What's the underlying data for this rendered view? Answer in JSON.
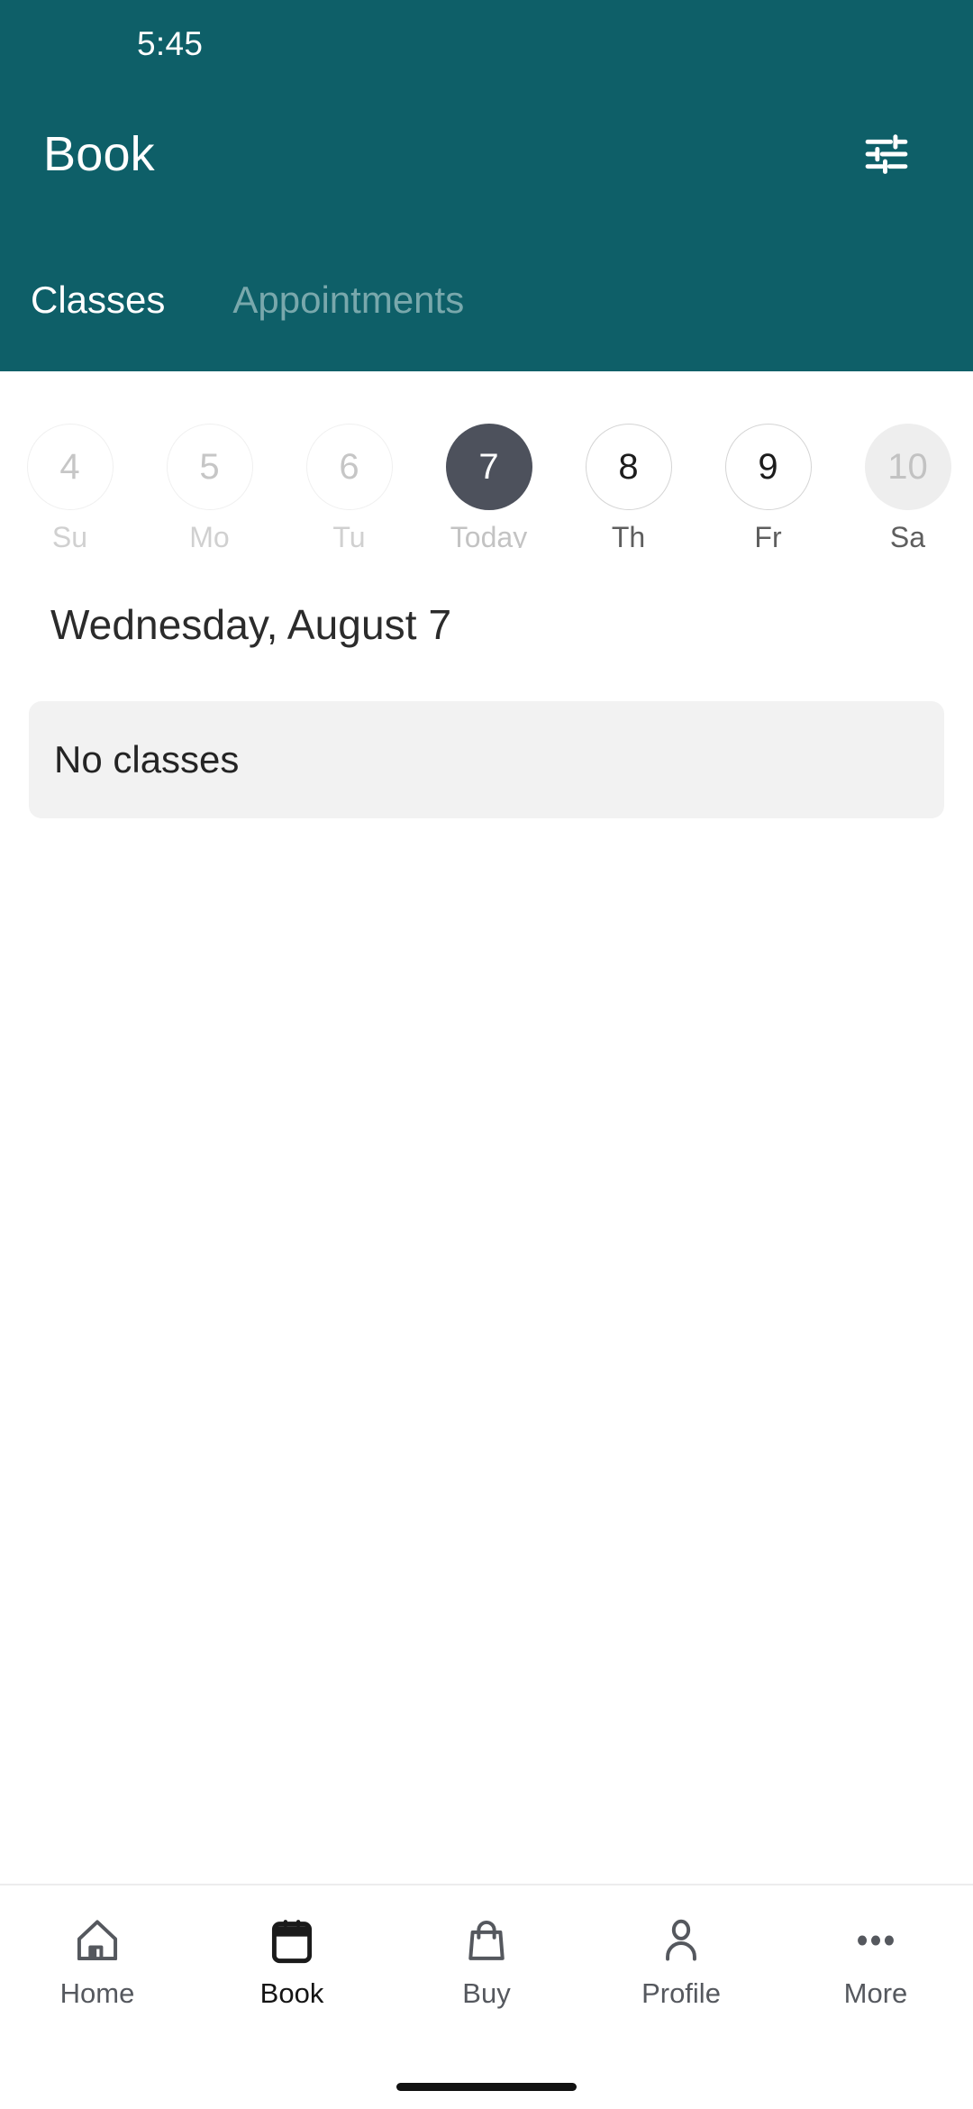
{
  "status_bar": {
    "time": "5:45"
  },
  "header": {
    "title": "Book",
    "filter_icon": "tune-icon",
    "background_color": "#0e5f68",
    "tabs": [
      {
        "label": "Classes",
        "active": true
      },
      {
        "label": "Appointments",
        "active": false
      }
    ]
  },
  "date_strip": {
    "days": [
      {
        "number": "4",
        "weekday": "Su",
        "state": "past"
      },
      {
        "number": "5",
        "weekday": "Mo",
        "state": "past"
      },
      {
        "number": "6",
        "weekday": "Tu",
        "state": "past"
      },
      {
        "number": "7",
        "weekday": "Today",
        "state": "selected"
      },
      {
        "number": "8",
        "weekday": "Th",
        "state": "future"
      },
      {
        "number": "9",
        "weekday": "Fr",
        "state": "future"
      },
      {
        "number": "10",
        "weekday": "Sa",
        "state": "highlight"
      }
    ],
    "selected_color": "#4d515c"
  },
  "main": {
    "day_heading": "Wednesday, August 7",
    "empty_state": {
      "text": "No classes",
      "background_color": "#f2f2f2"
    }
  },
  "bottom_nav": {
    "items": [
      {
        "label": "Home",
        "icon": "home-icon",
        "active": false
      },
      {
        "label": "Book",
        "icon": "calendar-icon",
        "active": true
      },
      {
        "label": "Buy",
        "icon": "bag-icon",
        "active": false
      },
      {
        "label": "Profile",
        "icon": "person-icon",
        "active": false
      },
      {
        "label": "More",
        "icon": "dots-icon",
        "active": false
      }
    ]
  }
}
